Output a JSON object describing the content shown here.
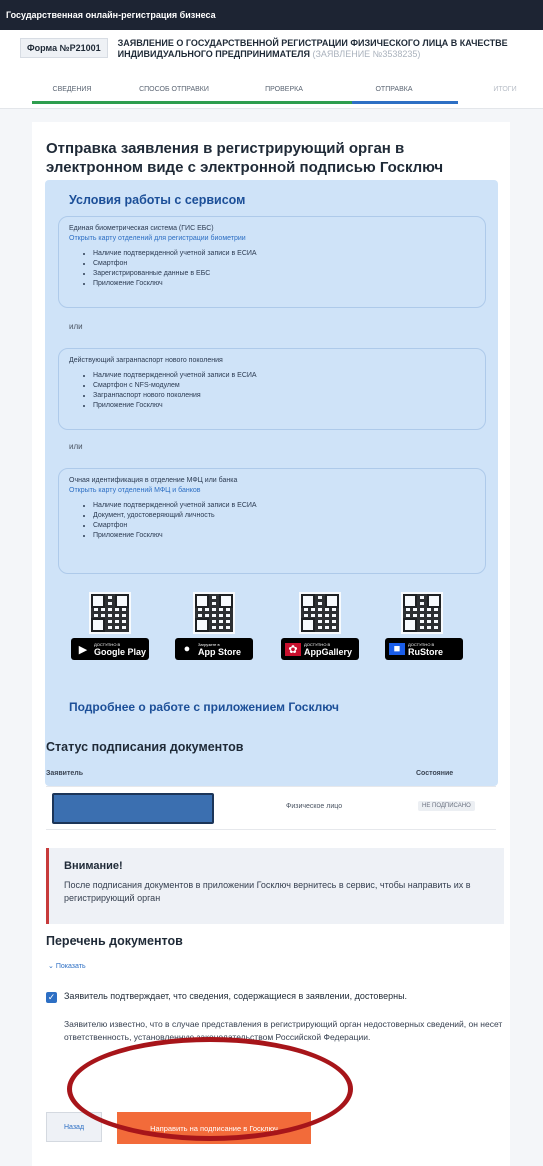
{
  "topbar": {
    "title": "Государственная онлайн-регистрация бизнеса"
  },
  "form": {
    "number": "Форма №Р21001",
    "title": "ЗАЯВЛЕНИЕ О ГОСУДАРСТВЕННОЙ РЕГИСТРАЦИИ ФИЗИЧЕСКОГО ЛИЦА В КАЧЕСТВЕ ИНДИВИДУАЛЬНОГО ПРЕДПРИНИМАТЕЛЯ",
    "app_no": "(ЗАЯВЛЕНИЕ №3538235)"
  },
  "steps": [
    {
      "label": "СВЕДЕНИЯ"
    },
    {
      "label": "СПОСОБ ОТПРАВКИ"
    },
    {
      "label": "ПРОВЕРКА"
    },
    {
      "label": "ОТПРАВКА"
    },
    {
      "label": "ИТОГИ"
    }
  ],
  "colors": {
    "done": "#2e9e4f",
    "active": "#2d6fc4",
    "accent": "#f26b3a"
  },
  "page": {
    "title": "Отправка заявления в регистрирующий орган в электронном виде с электронной подписью Госключ"
  },
  "service": {
    "title": "Условия работы с сервисом",
    "or": "или",
    "options": [
      {
        "head": "Единая биометрическая система (ГИС ЕБС)",
        "link": "Открыть карту отделений для регистрации биометрии",
        "items": [
          "Наличие подтвержденной учетной записи в ЕСИА",
          "Смартфон",
          "Зарегистрированные данные в ЕБС",
          "Приложение Госключ"
        ]
      },
      {
        "head": "Действующий загранпаспорт нового поколения",
        "link": "",
        "items": [
          "Наличие подтвержденной учетной записи в ЕСИА",
          "Смартфон с NFS-модулем",
          "Загранпаспорт нового поколения",
          "Приложение Госключ"
        ]
      },
      {
        "head": "Очная идентификация в отделение МФЦ или банка",
        "link": "Открыть карту отделений МФЦ и банков",
        "items": [
          "Наличие подтвержденной учетной записи в ЕСИА",
          "Документ, удостоверяющий личность",
          "Смартфон",
          "Приложение Госключ"
        ]
      }
    ],
    "stores": [
      {
        "sub": "ДОСТУПНО В",
        "name": "Google Play",
        "icon": "play-icon"
      },
      {
        "sub": "Загрузите в",
        "name": "App Store",
        "icon": "apple-icon"
      },
      {
        "sub": "ДОСТУПНО В",
        "name": "AppGallery",
        "icon": "huawei-icon"
      },
      {
        "sub": "ДОСТУПНО В",
        "name": "RuStore",
        "icon": "rustore-icon"
      }
    ],
    "more_link": "Подробнее о работе с приложением Госключ"
  },
  "status": {
    "title": "Статус подписания документов",
    "col_applicant": "Заявитель",
    "col_state": "Состояние",
    "row": {
      "type": "Физическое лицо",
      "state": "НЕ ПОДПИСАНО"
    }
  },
  "alert": {
    "title": "Внимание!",
    "text": "После подписания документов в приложении Госключ вернитесь в сервис, чтобы направить их в регистрирующий орган"
  },
  "docs": {
    "title": "Перечень документов",
    "show": "Показать",
    "confirm": "Заявитель подтверждает, что сведения, содержащиеся в заявлении, достоверны.",
    "note": "Заявителю известно, что в случае представления в регистрирующий орган недостоверных сведений, он несет ответственность, установленную законодательством Российской Федерации."
  },
  "actions": {
    "back": "Назад",
    "send": "Направить на подписание в Госключ"
  }
}
